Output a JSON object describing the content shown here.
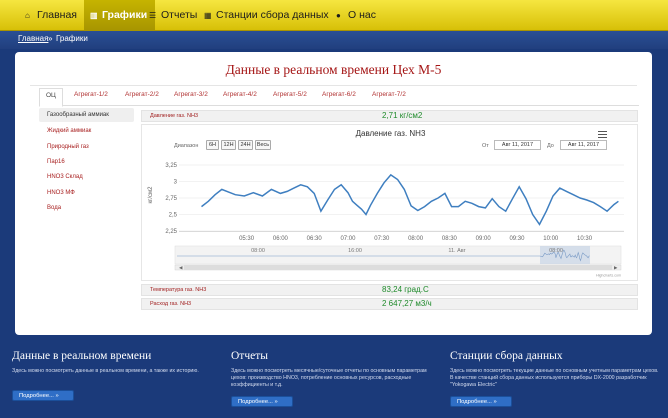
{
  "nav": [
    {
      "icon": "home-icon",
      "glyph": "⌂",
      "label": "Главная",
      "active": false
    },
    {
      "icon": "chart-icon",
      "glyph": "▥",
      "label": "Графики",
      "active": true
    },
    {
      "icon": "list-icon",
      "glyph": "☰",
      "label": "Отчеты",
      "active": false
    },
    {
      "icon": "grid-icon",
      "glyph": "▦",
      "label": "Станции сбора данных",
      "active": false
    },
    {
      "icon": "info-icon",
      "glyph": "●",
      "label": "О нас",
      "active": false
    }
  ],
  "breadcrumb": {
    "home": "Главная",
    "separator": "»",
    "current": "Графики"
  },
  "page": {
    "title": "Данные в реальном времени Цех М-5"
  },
  "tabs": [
    "ОЦ",
    "Агрегат-1/2",
    "Агрегат-2/2",
    "Агрегат-3/2",
    "Агрегат-4/2",
    "Агрегат-5/2",
    "Агрегат-6/2",
    "Агрегат-7/2"
  ],
  "sidebar": [
    {
      "label": "Газообразный аммиак",
      "active": true
    },
    {
      "label": "Жидкий аммиак",
      "active": false
    },
    {
      "label": "Природный газ",
      "active": false
    },
    {
      "label": "Пар16",
      "active": false
    },
    {
      "label": "HNO3 Склад",
      "active": false
    },
    {
      "label": "HNO3 МФ",
      "active": false
    },
    {
      "label": "Вода",
      "active": false
    }
  ],
  "params": [
    {
      "name": "Давление газ. NH3",
      "value": "2,71 кг/см2"
    },
    {
      "name": "Температура газ. NH3",
      "value": "83,24 град.С"
    },
    {
      "name": "Расход газ. NH3",
      "value": "2 647,27 м3/ч"
    }
  ],
  "chart_controls": {
    "range_label": "Диапазон",
    "range_buttons": [
      "6H",
      "12H",
      "24H",
      "Весь"
    ],
    "from_label": "От",
    "from_date": "Авг 11, 2017",
    "to_label": "До",
    "to_date": "Авг 11, 2017",
    "credit": "Highcharts.com"
  },
  "chart_data": {
    "type": "line",
    "title": "Давление газ. NH3",
    "ylabel": "кг/см2",
    "ylim": [
      2.25,
      3.25
    ],
    "yticks": [
      "2,25",
      "2,5",
      "2,75",
      "3",
      "3,25"
    ],
    "xticks": [
      "05:30",
      "06:00",
      "06:30",
      "07:00",
      "07:30",
      "08:00",
      "08:30",
      "09:00",
      "09:30",
      "10:00",
      "10:30"
    ],
    "navigator_ticks": [
      "08:00",
      "16:00",
      "11. Авг",
      "08:00"
    ],
    "x_minutes": [
      290,
      296,
      302,
      308,
      314,
      320,
      328,
      336,
      344,
      352,
      360,
      366,
      372,
      378,
      384,
      390,
      396,
      402,
      408,
      414,
      420,
      424,
      428,
      432,
      436,
      440,
      446,
      452,
      458,
      464,
      470,
      476,
      482,
      488,
      494,
      500,
      506,
      512,
      518,
      524,
      530,
      536,
      542,
      548,
      554,
      560,
      566,
      572,
      578,
      584,
      590,
      596,
      602,
      608,
      614,
      620,
      626,
      632,
      638,
      644,
      650,
      656,
      660
    ],
    "values": [
      2.62,
      2.7,
      2.8,
      2.88,
      2.84,
      2.8,
      2.78,
      2.83,
      2.78,
      2.88,
      2.82,
      2.85,
      2.9,
      2.95,
      2.92,
      2.82,
      2.55,
      2.72,
      2.88,
      2.95,
      2.83,
      2.7,
      2.64,
      2.58,
      2.5,
      2.64,
      2.82,
      2.98,
      3.1,
      3.03,
      2.88,
      2.63,
      2.56,
      2.62,
      2.7,
      2.75,
      2.82,
      2.62,
      2.62,
      2.7,
      2.67,
      2.62,
      2.6,
      2.74,
      2.62,
      2.55,
      2.74,
      2.92,
      2.74,
      2.5,
      2.35,
      2.55,
      2.78,
      2.9,
      2.85,
      2.8,
      2.75,
      2.72,
      2.68,
      2.62,
      2.55,
      2.65,
      2.7
    ]
  },
  "footer": [
    {
      "title": "Данные в реальном времени",
      "text": "Здесь можно посмотреть данные в реальном времени, а также их историю.",
      "button": "Подробнее... »"
    },
    {
      "title": "Отчеты",
      "text": "Здесь можно посмотреть месячные/суточные отчеты по основным параметрам цехов: производство HNO3, потребление основных ресурсов, расходные коэффициенты и т.д.",
      "button": "Подробнее... »"
    },
    {
      "title": "Станции сбора данных",
      "text": "Здесь можно посмотреть текущие данные по основным учетным параметрам цехов. В качестве станций сбора данных используются приборы DX-2000 разработчик \"Yokogawa Electric\"",
      "button": "Подробнее... »"
    }
  ]
}
